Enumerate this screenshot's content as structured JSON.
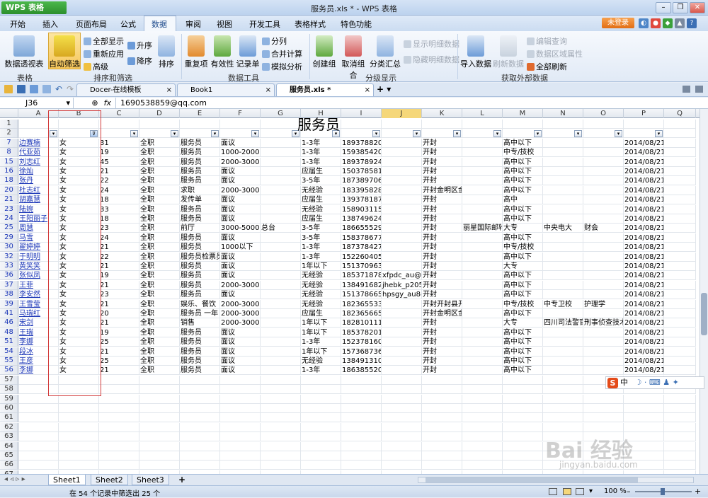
{
  "window": {
    "app_button": "WPS 表格",
    "title": "服务员.xls * - WPS 表格"
  },
  "menu": {
    "items": [
      "开始",
      "插入",
      "页面布局",
      "公式",
      "数据",
      "审阅",
      "视图",
      "开发工具",
      "表格样式",
      "特色功能"
    ],
    "active": "数据",
    "login": "未登录"
  },
  "ribbon": {
    "pivot": "数据透视表",
    "autofilter": "自动筛选",
    "show_all": "全部显示",
    "reapply": "重新应用",
    "advanced": "高级",
    "asc": "升序",
    "desc": "降序",
    "sort": "排序",
    "dup": "重复项",
    "validity": "有效性",
    "record": "记录单",
    "split": "分列",
    "merge_calc": "合并计算",
    "what_if": "模拟分析",
    "create_group": "创建组",
    "ungroup": "取消组合",
    "subtotal": "分类汇总",
    "show_detail": "显示明细数据",
    "hide_detail": "隐藏明细数据",
    "import": "导入数据",
    "refresh": "刷新数据",
    "edit_query": "编辑查询",
    "range_props": "数据区域属性",
    "refresh_all": "全部刷新",
    "groups": {
      "table": "表格",
      "sort_filter": "排序和筛选",
      "data_tools": "数据工具",
      "outline": "分级显示",
      "external": "获取外部数据"
    }
  },
  "doc_tabs": [
    "Docer-在线模板",
    "Book1",
    "服务员.xls *"
  ],
  "formula_bar": {
    "cell": "J36",
    "fx": "fx",
    "content": "1690538859@qq.com"
  },
  "sheet": {
    "title": "服务员",
    "columns": [
      "A",
      "B",
      "C",
      "D",
      "E",
      "F",
      "G",
      "H",
      "I",
      "J",
      "K",
      "L",
      "M",
      "N",
      "O",
      "P",
      "Q"
    ],
    "selected_column": "J",
    "rows": [
      {
        "r": "1",
        "c": []
      },
      {
        "r": "2",
        "c": []
      },
      {
        "r": "7",
        "c": [
          "边赛楠",
          "女",
          "31",
          "全职",
          "服务员",
          "面议",
          "",
          "1-3年",
          "1893788205",
          "",
          "开封",
          "",
          "高中以下",
          "",
          "",
          "2014/08/21"
        ]
      },
      {
        "r": "8",
        "c": [
          "代亚茹",
          "女",
          "19",
          "全职",
          "服务员",
          "1000-2000",
          "",
          "1-3年",
          "1593854207",
          "",
          "开封",
          "",
          "中专/技校",
          "",
          "",
          "2014/08/21"
        ]
      },
      {
        "r": "15",
        "c": [
          "刘志红",
          "女",
          "45",
          "全职",
          "服务员",
          "2000-3000",
          "",
          "1-3年",
          "1893789242",
          "",
          "开封",
          "",
          "高中以下",
          "",
          "",
          "2014/08/21"
        ]
      },
      {
        "r": "16",
        "c": [
          "徐灿",
          "女",
          "21",
          "全职",
          "服务员",
          "面议",
          "",
          "应届生",
          "1503785811",
          "",
          "开封",
          "",
          "高中以下",
          "",
          "",
          "2014/08/21"
        ]
      },
      {
        "r": "18",
        "c": [
          "张丹",
          "女",
          "22",
          "全职",
          "服务员",
          "面议",
          "",
          "3-5年",
          "1873897060",
          "",
          "开封",
          "",
          "高中以下",
          "",
          "",
          "2014/08/21"
        ]
      },
      {
        "r": "20",
        "c": [
          "杜志红",
          "女",
          "24",
          "全职",
          "求职",
          "2000-3000",
          "",
          "无经验",
          "1833958283",
          "",
          "开封金明区金",
          "",
          "高中以下",
          "",
          "",
          "2014/08/21"
        ]
      },
      {
        "r": "21",
        "c": [
          "胡嘉慧",
          "女",
          "18",
          "全职",
          "发传单",
          "面议",
          "",
          "应届生",
          "13937818739715364790",
          "",
          "开封",
          "",
          "高中",
          "",
          "",
          "2014/08/21"
        ]
      },
      {
        "r": "23",
        "c": [
          "陆婉",
          "女",
          "33",
          "全职",
          "服务员",
          "面议",
          "",
          "无经验",
          "1589031155",
          "",
          "开封",
          "",
          "高中以下",
          "",
          "",
          "2014/08/21"
        ]
      },
      {
        "r": "24",
        "c": [
          "王阳丽子",
          "女",
          "18",
          "全职",
          "服务员",
          "面议",
          "",
          "应届生",
          "1387496243",
          "",
          "开封",
          "",
          "高中以下",
          "",
          "",
          "2014/08/21"
        ]
      },
      {
        "r": "25",
        "c": [
          "周慧",
          "女",
          "23",
          "全职",
          "前厅",
          "3000-5000",
          "总台",
          "3-5年",
          "1866555292",
          "",
          "开封",
          "丽星国际邮轮",
          "大专",
          "中央电大",
          "财会",
          "2014/08/21"
        ]
      },
      {
        "r": "29",
        "c": [
          "马雪",
          "女",
          "24",
          "全职",
          "服务员",
          "面议",
          "",
          "3-5年",
          "1583786779",
          "",
          "开封",
          "",
          "高中以下",
          "",
          "",
          "2014/08/21"
        ]
      },
      {
        "r": "30",
        "c": [
          "翟婷婷",
          "女",
          "21",
          "全职",
          "服务员",
          "1000以下",
          "",
          "1-3年",
          "1873784279",
          "",
          "开封",
          "",
          "中专/技校",
          "",
          "",
          "2014/08/21"
        ]
      },
      {
        "r": "32",
        "c": [
          "于明明",
          "女",
          "22",
          "全职",
          "服务员检票员",
          "面议",
          "",
          "1-3年",
          "1522604051",
          "",
          "开封",
          "",
          "高中以下",
          "",
          "",
          "2014/08/21"
        ]
      },
      {
        "r": "33",
        "c": [
          "黄笑笑",
          "女",
          "21",
          "全职",
          "服务员",
          "面议",
          "",
          "1年以下",
          "15137096328513361260",
          "",
          "开封",
          "",
          "大专",
          "",
          "",
          "2014/08/21"
        ]
      },
      {
        "r": "36",
        "c": [
          "张似凤",
          "女",
          "19",
          "全职",
          "服务员",
          "面议",
          "",
          "无经验",
          "1853718788",
          "xfpdc_au@qq.",
          "开封",
          "",
          "高中以下",
          "",
          "",
          "2014/08/21"
        ]
      },
      {
        "r": "37",
        "c": [
          "王菲",
          "女",
          "21",
          "全职",
          "服务员",
          "2000-3000",
          "",
          "无经验",
          "1384916823",
          "jhebk_p205",
          "开封",
          "",
          "高中以下",
          "",
          "",
          "2014/08/21"
        ]
      },
      {
        "r": "38",
        "c": [
          "李安然",
          "女",
          "23",
          "全职",
          "服务员",
          "面议",
          "",
          "无经验",
          "1513786655",
          "hpsgy_au8@",
          "开封",
          "",
          "高中以下",
          "",
          "",
          "2014/08/21"
        ]
      },
      {
        "r": "39",
        "c": [
          "王雪莹",
          "女",
          "21",
          "全职",
          "娱乐、餐饮",
          "2000-3000",
          "",
          "无经验",
          "18236553371429132983",
          "",
          "开封开封县开",
          "",
          "中专/技校",
          "中专卫校",
          "护理学",
          "2014/08/21"
        ]
      },
      {
        "r": "41",
        "c": [
          "马瑞红",
          "女",
          "20",
          "全职",
          "服务员 一年",
          "2000-3000",
          "",
          "应届生",
          "1823656650",
          "",
          "开封金明区金",
          "",
          "高中以下",
          "",
          "",
          "2014/08/21"
        ]
      },
      {
        "r": "46",
        "c": [
          "宋剑",
          "女",
          "21",
          "全职",
          "销售",
          "2000-3000",
          "",
          "1年以下",
          "18281011185250026480",
          "",
          "开封",
          "",
          "大专",
          "四川司法警官",
          "刑事侦查技术",
          "2014/08/21"
        ]
      },
      {
        "r": "48",
        "c": [
          "王瑞",
          "女",
          "19",
          "全职",
          "服务员",
          "面议",
          "",
          "1年以下",
          "1853782018",
          "",
          "开封",
          "",
          "高中以下",
          "",
          "",
          "2014/08/21"
        ]
      },
      {
        "r": "51",
        "c": [
          "李娜",
          "女",
          "25",
          "全职",
          "服务员",
          "面议",
          "",
          "1-3年",
          "1523781604",
          "",
          "开封",
          "",
          "高中以下",
          "",
          "",
          "2014/08/21"
        ]
      },
      {
        "r": "54",
        "c": [
          "段冰",
          "女",
          "21",
          "全职",
          "服务员",
          "面议",
          "",
          "1年以下",
          "1573687368",
          "",
          "开封",
          "",
          "高中以下",
          "",
          "",
          "2014/08/21"
        ]
      },
      {
        "r": "55",
        "c": [
          "王彦",
          "女",
          "25",
          "全职",
          "服务员",
          "面议",
          "",
          "无经验",
          "1384913103",
          "",
          "开封",
          "",
          "高中以下",
          "",
          "",
          "2014/08/21"
        ]
      },
      {
        "r": "56",
        "c": [
          "李娜",
          "女",
          "21",
          "全职",
          "服务员",
          "面议",
          "",
          "1-3年",
          "1863855203",
          "",
          "开封",
          "",
          "高中以下",
          "",
          "",
          "2014/08/21"
        ]
      },
      {
        "r": "57",
        "c": []
      },
      {
        "r": "58",
        "c": []
      },
      {
        "r": "59",
        "c": []
      },
      {
        "r": "60",
        "c": []
      },
      {
        "r": "61",
        "c": []
      },
      {
        "r": "62",
        "c": []
      },
      {
        "r": "63",
        "c": []
      },
      {
        "r": "64",
        "c": []
      },
      {
        "r": "65",
        "c": []
      },
      {
        "r": "66",
        "c": []
      },
      {
        "r": "67",
        "c": []
      }
    ]
  },
  "sheet_tabs": [
    "Sheet1",
    "Sheet2",
    "Sheet3"
  ],
  "status": {
    "text": "在 54 个记录中筛选出 25 个",
    "zoom": "100 %"
  },
  "ime": {
    "label": "中"
  },
  "watermark": {
    "main": "Bai 经验",
    "sub": "jingyan.baidu.com"
  },
  "colors": {
    "accent": "#2c8f2c",
    "title_bar": "#bcd2ee",
    "highlight_box": "#d23b3b",
    "selected_col": "#f5d77a",
    "link_text": "#1a35b7"
  }
}
